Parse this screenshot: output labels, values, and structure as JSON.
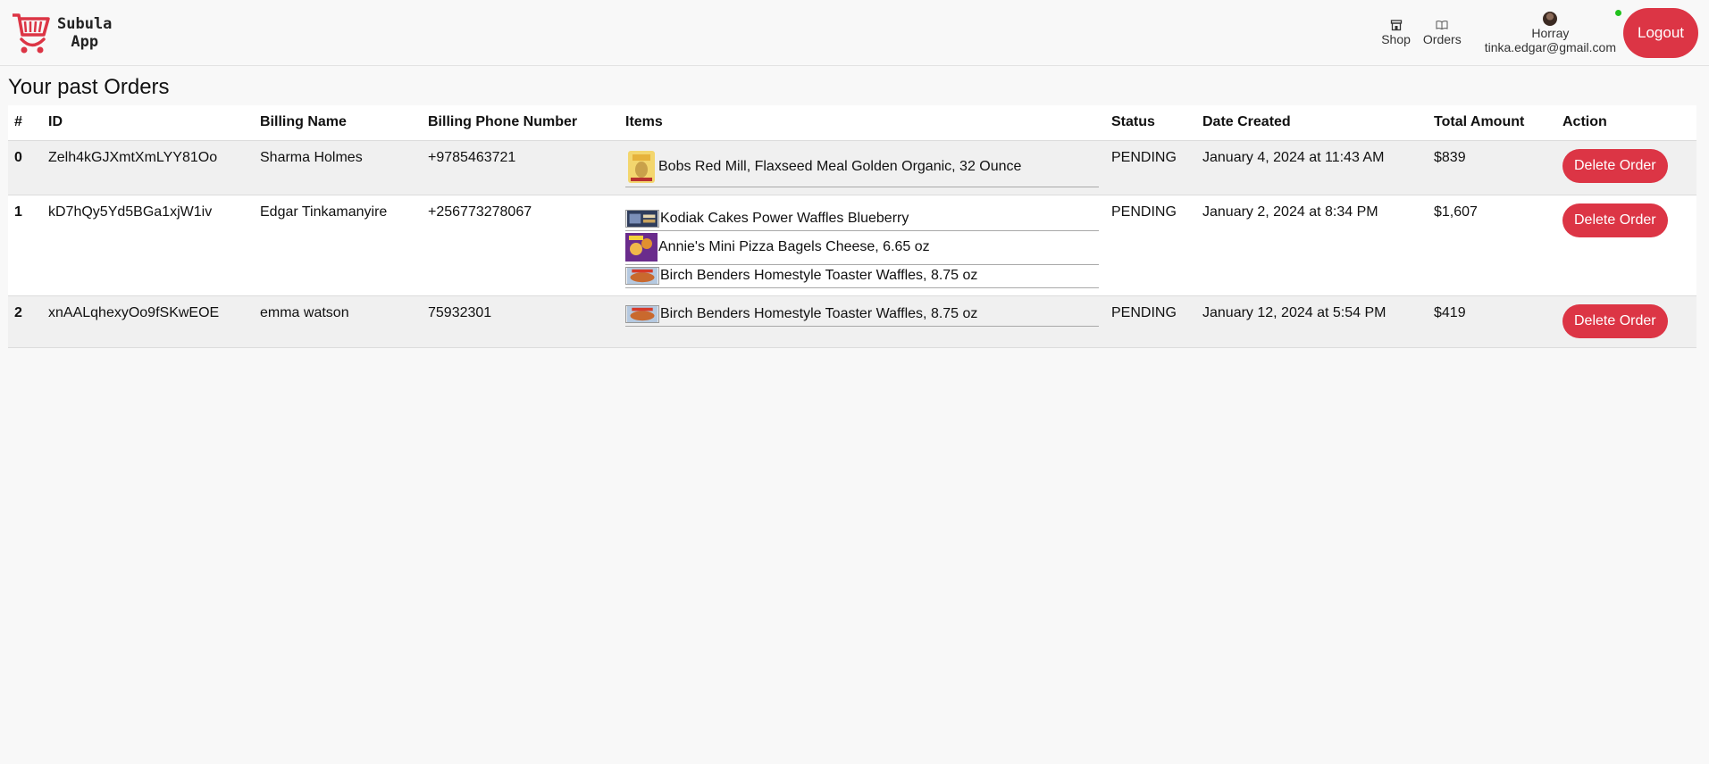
{
  "brand": {
    "line1": "Subula",
    "line2": "App",
    "color": "#dc3545"
  },
  "nav": {
    "shop_label": "Shop",
    "orders_label": "Orders",
    "user_name": "Horray",
    "user_email": "tinka.edgar@gmail.com",
    "logout_label": "Logout"
  },
  "page": {
    "title": "Your past Orders"
  },
  "table": {
    "headers": [
      "#",
      "ID",
      "Billing Name",
      "Billing Phone Number",
      "Items",
      "Status",
      "Date Created",
      "Total Amount",
      "Action"
    ],
    "rows": [
      {
        "index": "0",
        "id": "Zelh4kGJXmtXmLYY81Oo",
        "billing_name": "Sharma Holmes",
        "billing_phone": "+9785463721",
        "items": [
          {
            "name": "Bobs Red Mill, Flaxseed Meal Golden Organic, 32 Ounce",
            "icon": "flaxseed-bag-thumbnail"
          }
        ],
        "status": "PENDING",
        "date_created": "January 4, 2024 at 11:43 AM",
        "total_amount": "$839",
        "action_label": "Delete Order"
      },
      {
        "index": "1",
        "id": "kD7hQy5Yd5BGa1xjW1iv",
        "billing_name": "Edgar Tinkamanyire",
        "billing_phone": "+256773278067",
        "items": [
          {
            "name": "Kodiak Cakes Power Waffles Blueberry",
            "icon": "waffle-box-thumbnail"
          },
          {
            "name": "Annie's Mini Pizza Bagels Cheese, 6.65 oz",
            "icon": "pizza-bagels-thumbnail"
          },
          {
            "name": "Birch Benders Homestyle Toaster Waffles, 8.75 oz",
            "icon": "toaster-waffles-thumbnail"
          }
        ],
        "status": "PENDING",
        "date_created": "January 2, 2024 at 8:34 PM",
        "total_amount": "$1,607",
        "action_label": "Delete Order"
      },
      {
        "index": "2",
        "id": "xnAALqhexyOo9fSKwEOE",
        "billing_name": "emma watson",
        "billing_phone": "75932301",
        "items": [
          {
            "name": "Birch Benders Homestyle Toaster Waffles, 8.75 oz",
            "icon": "toaster-waffles-thumbnail"
          }
        ],
        "status": "PENDING",
        "date_created": "January 12, 2024 at 5:54 PM",
        "total_amount": "$419",
        "action_label": "Delete Order"
      }
    ]
  }
}
